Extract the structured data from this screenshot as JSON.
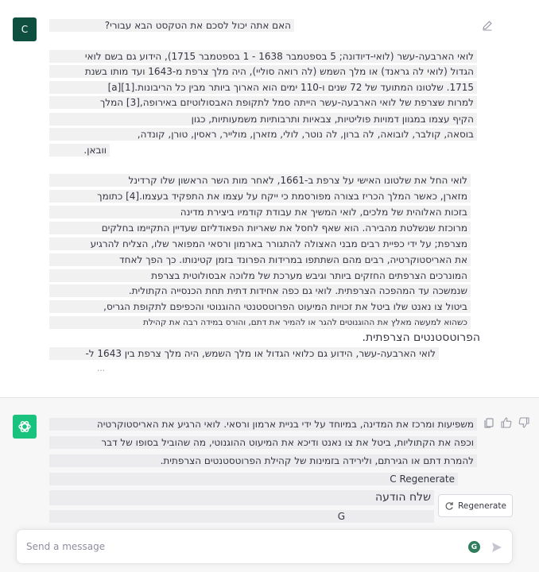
{
  "user": {
    "avatar_letter": "C",
    "question": "האם אתה יכול לסכם את הטקסט הבא עבורי?",
    "para1": [
      "לואי הארבעה-עשר (לואי-דיודונה; 5 בספטמבר 1638 - 1 בספטמבר 1715), הידוע גם בשם לואי",
      "הגדול (לואי לה גראנד) או מלך השמש (לה רואה סוליי), היה מלך צרפת מ-1643 ועד מותו בשנת",
      "1715. שלטונו המתועד של 72 שנים ו-110 ימים הוא הארוך ביותר מבין כל הריבונות.[1][a]",
      "למרות שצרפת של לואי הארבעה-עשר הייתה סמל לתקופת האבסולוטיזם באירופה,[3] המלך",
      "הקיף עצמו במגוון דמויות פוליטיות, צבאיות ותרבותיות משמעותיות, כגון",
      "בוסאה, קולבר, לובואה, לה ברון, לה נוטר, לולי, מזארן, מולייר, ראסין, טורן, קונדה,",
      "וובאן."
    ],
    "para2": [
      "לואי החל את שלטונו האישי על צרפת ב-1661, לאחר מות השר הראשון שלו קרדינל",
      "מזארן, כאשר המלך הכריז בצורה מפורסמת כי ייקח על עצמו את התפקיד בעצמו.[4] כתומך",
      "בזכות האלוהית של מלכים, לואי המשיך את עבודת קודמיו ביצירת מדינה",
      "מרוכזת שנשלטת מהבירה. הוא שאף לחסל את שאריות הפאודליזם שעדיין התקיימו בחלקים",
      "מצרפת; על ידי כפיית רבים מבני האצולה להתגורר בארמון ורסאי המפואר שלו, הצליח להרגיע",
      "את האריסטוקרטיה, רבים מהם השתתפו במרידות הפרונד בזמן קטינותו. כך הפך לאחד",
      "המונרכים הצרפתים החזקים ביותר וגיבש מערכת של מלוכה אבסולוטית בצרפת",
      "שנמשכה עד המהפכה הצרפתית. לואי גם כפה אחידות דתית תחת הכנסייה הקתולית.",
      "ביטול צו נאנט שלו ביטל את זכויות המיעוט הפרוטסטנטי ההוגנוטי והכפיפם לתקופת הגריס,",
      "כשהוא למעשה מאלץ את ההוגנוטים להגר או להמיר את דתם, והורס במידה רבה את קהילת",
      "הפרוטסטנטים הצרפתית.",
      "לואי הארבעה-עשר, הידוע גם כלואי הגדול או מלך השמש, היה מלך צרפת בין 1643 ל-",
      "..."
    ]
  },
  "assistant": {
    "lines": [
      "משפיעות ומרכז את המדינה, במיוחד על ידי בניית ארמון ורסאי. לואי הרגיע את האריסטוקרטיה",
      "וכפה את הקתוליות, ביטל את צו נאנט ודיכא את המיעוט ההוגנוטי, מה שהוביל בסופו של דבר",
      "להמרת דתם או הגירתם, ולירידה בזמינות של קהילת הפרוטסטנטים הצרפתית."
    ],
    "extra_regenerate": "C Regenerate",
    "extra_send": "שלח הודעה",
    "extra_g": "G",
    "regenerate_label": "Regenerate"
  },
  "composer": {
    "placeholder": "Send a message",
    "badge_letter": "G"
  },
  "icons": {
    "user_edit": "edit-icon",
    "copy": "copy-icon",
    "thumbs_up": "thumbs-up-icon",
    "thumbs_down": "thumbs-down-icon",
    "regenerate": "refresh-icon",
    "send": "send-icon",
    "bot_logo": "openai-logo-icon"
  },
  "colors": {
    "user_avatar": "#0f4f3f",
    "bot_avatar": "#19c37d",
    "badge": "#2e7d5b"
  }
}
